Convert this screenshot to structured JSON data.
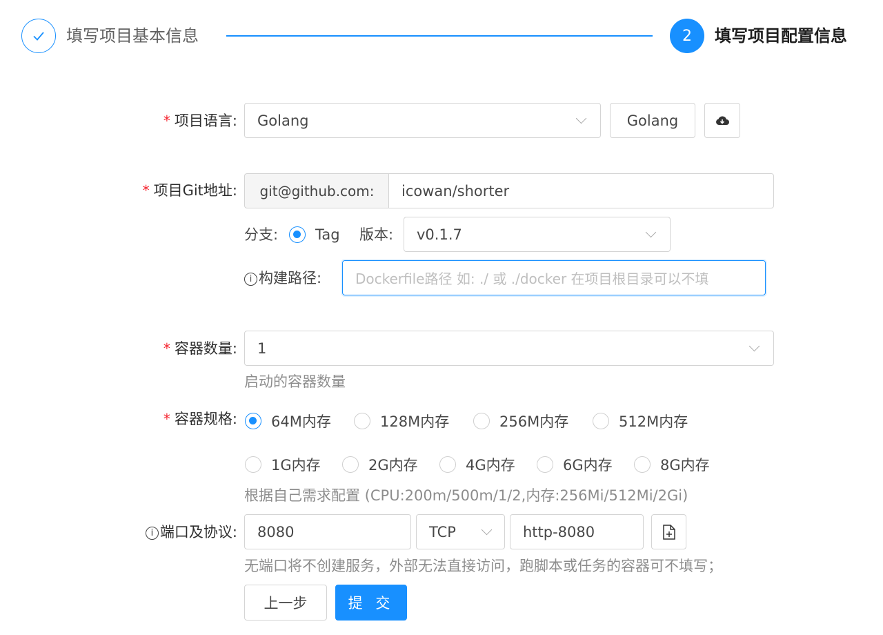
{
  "steps": [
    {
      "title": "填写项目基本信息",
      "state": "done"
    },
    {
      "title": "填写项目配置信息",
      "state": "active",
      "number": "2"
    }
  ],
  "form": {
    "language": {
      "label": "项目语言:",
      "value": "Golang",
      "button_label": "Golang"
    },
    "git": {
      "label": "项目Git地址:",
      "prefix": "git@github.com:",
      "value": "icowan/shorter",
      "branch_label": "分支:",
      "branch_option": "Tag",
      "version_label": "版本:",
      "version_value": "v0.1.7",
      "build_path_label": "构建路径:",
      "build_path_placeholder": "Dockerfile路径 如: ./ 或 ./docker 在项目根目录可以不填"
    },
    "replicas": {
      "label": "容器数量:",
      "value": "1",
      "help": "启动的容器数量"
    },
    "spec": {
      "label": "容器规格:",
      "selected": "64M内存",
      "options_row1": [
        "64M内存",
        "128M内存",
        "256M内存",
        "512M内存"
      ],
      "options_row2": [
        "1G内存",
        "2G内存",
        "4G内存",
        "6G内存",
        "8G内存"
      ],
      "help": "根据自己需求配置 (CPU:200m/500m/1/2,内存:256Mi/512Mi/2Gi)"
    },
    "port": {
      "label": "端口及协议:",
      "port_value": "8080",
      "protocol_value": "TCP",
      "name_value": "http-8080",
      "help": "无端口将不创建服务，外部无法直接访问，跑脚本或任务的容器可不填写；"
    },
    "actions": {
      "prev_label": "上一步",
      "submit_label": "提 交"
    }
  },
  "colors": {
    "primary": "#1890ff",
    "required": "#f5222d",
    "border": "#d4d4d4",
    "addon_bg": "#f5f5f5"
  },
  "icons": {
    "done_step": "check-icon",
    "language_button": "cloud-download-icon",
    "port_add": "file-add-icon",
    "info": "info-icon",
    "select": "chevron-down-icon"
  }
}
